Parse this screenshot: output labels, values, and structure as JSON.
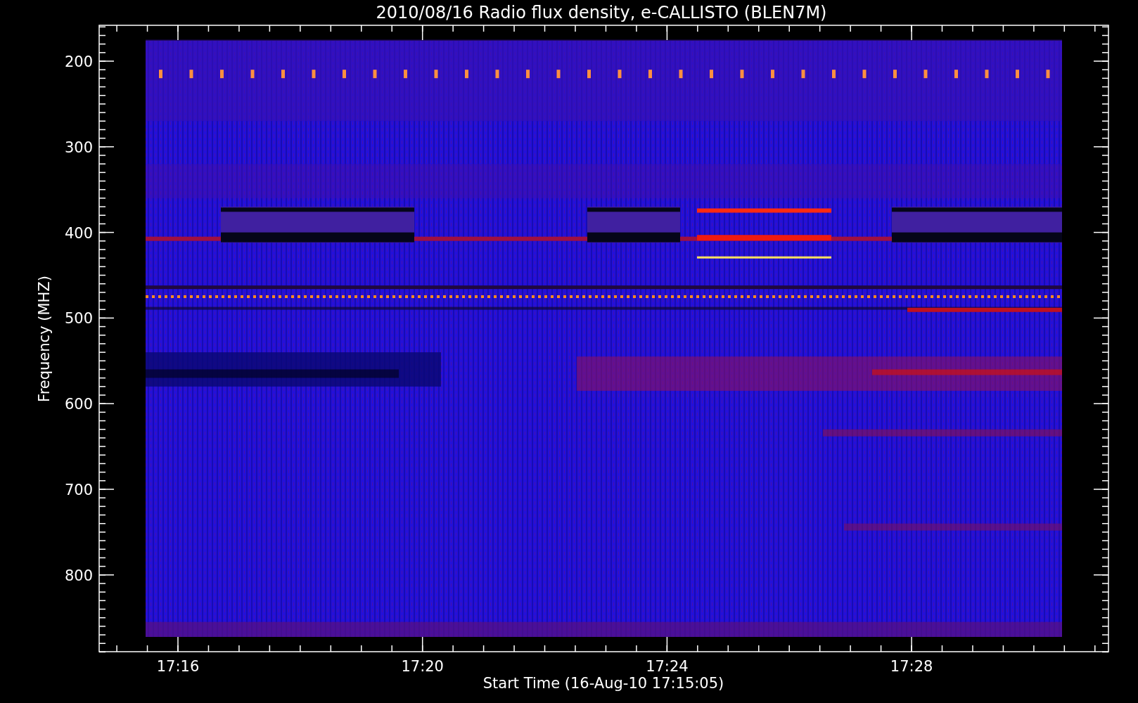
{
  "title": "2010/08/16  Radio flux density, e-CALLISTO (BLEN7M)",
  "y_axis": {
    "label": "Frequency (MHZ)",
    "ticks": [
      "200",
      "300",
      "400",
      "500",
      "600",
      "700",
      "800"
    ]
  },
  "x_axis": {
    "label": "Start Time (16-Aug-10 17:15:05)",
    "ticks": [
      "17:16",
      "17:20",
      "17:24",
      "17:28"
    ]
  }
}
